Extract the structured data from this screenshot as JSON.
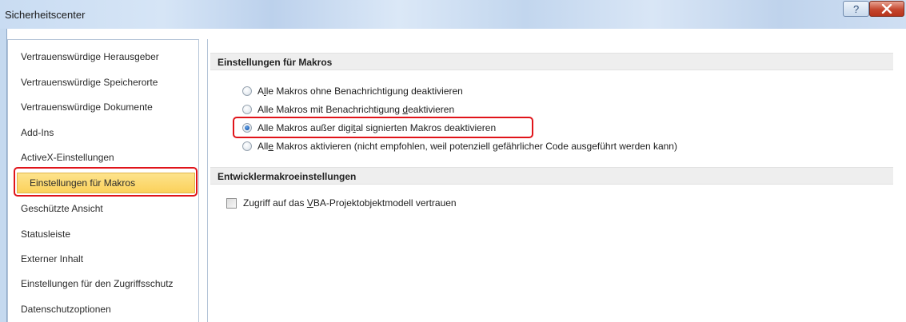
{
  "window": {
    "title": "Sicherheitscenter",
    "help_glyph": "?",
    "close_glyph": "X"
  },
  "sidebar": {
    "items": [
      {
        "label": "Vertrauenswürdige Herausgeber"
      },
      {
        "label": "Vertrauenswürdige Speicherorte"
      },
      {
        "label": "Vertrauenswürdige Dokumente"
      },
      {
        "label": "Add-Ins"
      },
      {
        "label": "ActiveX-Einstellungen"
      },
      {
        "label": "Einstellungen für Makros",
        "selected": true
      },
      {
        "label": "Geschützte Ansicht"
      },
      {
        "label": "Statusleiste"
      },
      {
        "label": "Externer Inhalt"
      },
      {
        "label": "Einstellungen für den Zugriffsschutz"
      },
      {
        "label": "Datenschutzoptionen"
      }
    ]
  },
  "macro_settings": {
    "header": "Einstellungen für Makros",
    "options": [
      {
        "pre": "A",
        "mnemonic": "l",
        "post": "le Makros ohne Benachrichtigung deaktivieren",
        "checked": false
      },
      {
        "pre": "Alle Makros mit Benachrichtigung ",
        "mnemonic": "d",
        "post": "eaktivieren",
        "checked": false
      },
      {
        "pre": "Alle Makros außer digi",
        "mnemonic": "t",
        "post": "al signierten Makros deaktivieren",
        "checked": true
      },
      {
        "pre": "All",
        "mnemonic": "e",
        "post": " Makros aktivieren (nicht empfohlen, weil potenziell gefährlicher Code ausgeführt werden kann)",
        "checked": false
      }
    ]
  },
  "developer_settings": {
    "header": "Entwicklermakroeinstellungen",
    "checkbox": {
      "pre": "Zugriff auf das ",
      "mnemonic": "V",
      "post": "BA-Projektobjektmodell vertrauen",
      "checked": false
    }
  },
  "colors": {
    "highlight_red": "#e0141a",
    "selected_item_bg": "#fbd15b",
    "radio_checked": "#1f5fb4"
  }
}
